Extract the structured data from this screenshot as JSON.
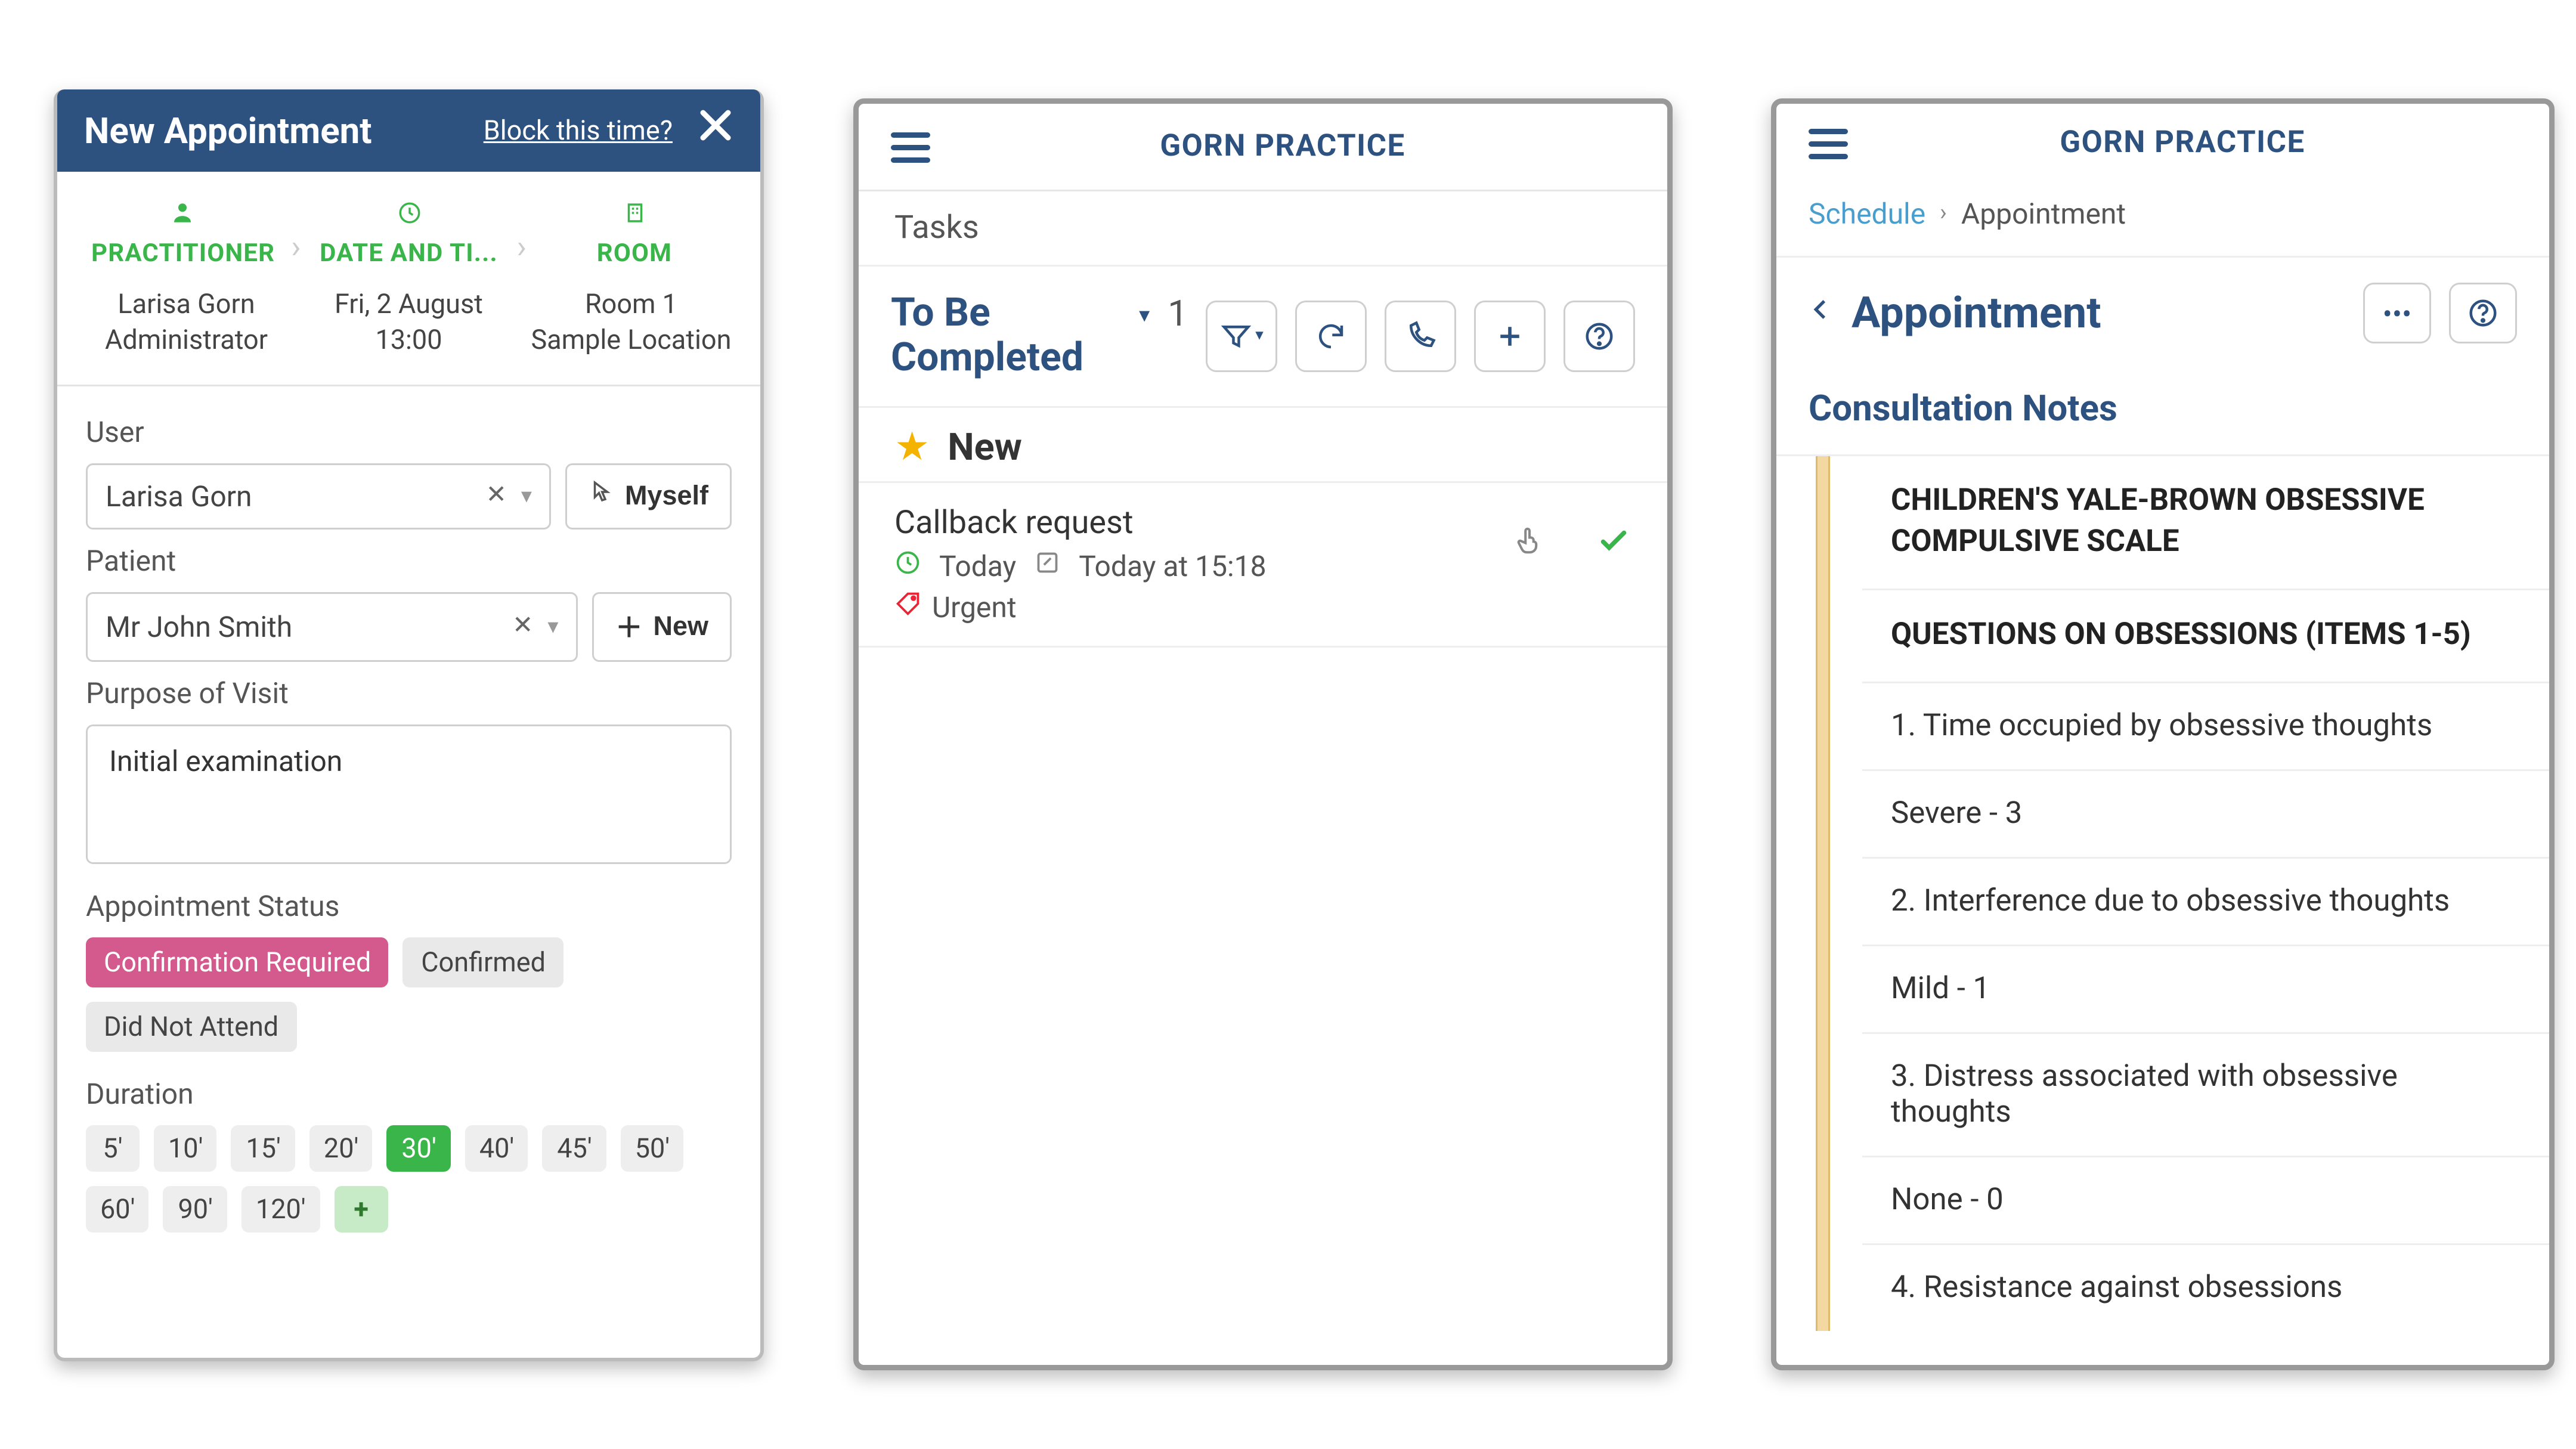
{
  "panel1": {
    "title": "New Appointment",
    "block_link": "Block this time?",
    "steps": {
      "practitioner": {
        "label": "PRACTITIONER",
        "name": "Larisa Gorn",
        "role": "Administrator"
      },
      "datetime": {
        "label": "DATE AND TI...",
        "date": "Fri, 2 August",
        "time": "13:00"
      },
      "room": {
        "label": "ROOM",
        "room": "Room 1",
        "location": "Sample Location"
      }
    },
    "user_label": "User",
    "user_value": "Larisa Gorn",
    "myself_label": "Myself",
    "patient_label": "Patient",
    "patient_value": "Mr John Smith",
    "new_label": "New",
    "purpose_label": "Purpose of Visit",
    "purpose_value": "Initial examination",
    "status_label": "Appointment Status",
    "status_options": [
      "Confirmation Required",
      "Confirmed",
      "Did Not Attend"
    ],
    "status_selected": "Confirmation Required",
    "duration_label": "Duration",
    "durations": [
      "5'",
      "10'",
      "15'",
      "20'",
      "30'",
      "40'",
      "45'",
      "50'",
      "60'",
      "90'",
      "120'"
    ],
    "duration_selected": "30'"
  },
  "panel2": {
    "brand": "GORN PRACTICE",
    "subheader": "Tasks",
    "filter_title": "To Be Completed",
    "count": "1",
    "section_label": "New",
    "task": {
      "title": "Callback request",
      "due": "Today",
      "created": "Today at 15:18",
      "tag": "Urgent"
    }
  },
  "panel3": {
    "brand": "GORN PRACTICE",
    "crumb1": "Schedule",
    "crumb2": "Appointment",
    "header": "Appointment",
    "notes_header": "Consultation Notes",
    "scale_title1": "CHILDREN'S YALE-BROWN OBSESSIVE",
    "scale_title2": "COMPULSIVE SCALE",
    "section_title": "QUESTIONS ON OBSESSIONS (ITEMS 1-5)",
    "items": [
      {
        "q": "1. Time occupied by obsessive thoughts",
        "a": "Severe - 3"
      },
      {
        "q": "2. Interference due to obsessive thoughts",
        "a": "Mild - 1"
      },
      {
        "q": "3. Distress associated with obsessive thoughts",
        "a": "None - 0"
      },
      {
        "q": "4. Resistance against obsessions",
        "a": ""
      }
    ]
  }
}
